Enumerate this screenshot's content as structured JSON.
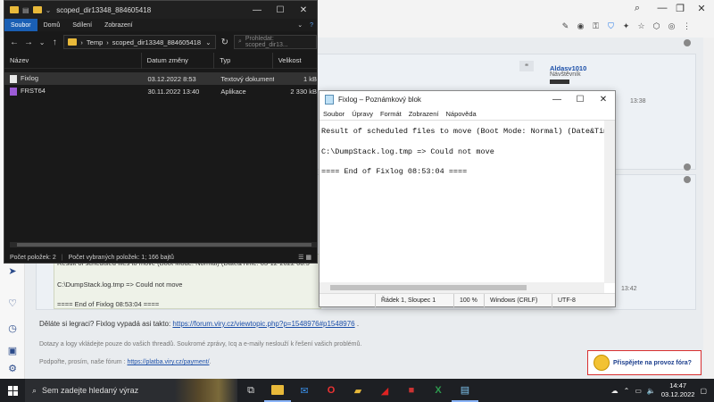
{
  "browser": {
    "forum": {
      "user_name": "Aldasv1010",
      "user_role": "Návštěvník",
      "time_top": "13:38",
      "time_bottom": "13:42",
      "quote_line1": "Result of scheduled files to move (Boot Mode: Normal) (Date&Time: 03-12-2022 08:5",
      "quote_line2": "C:\\DumpStack.log.tmp => Could not move",
      "quote_line3": "==== End of Fixlog 08:53:04 ====",
      "legacy_text": "Děláte si legraci? Fixlog vypadá asi takto:",
      "legacy_link": "https://forum.viry.cz/viewtopic.php?p=1548976#p1548976",
      "note1": "Dotazy a logy vkládejte pouze do vašich threadů. Soukromé zprávy, Icq a e-maily neslouží k řešení vašich problémů.",
      "note2": "Podpořte, prosím, naše fórum :",
      "note2_link": "https://platba.viry.cz/payment/",
      "donate_label": "Přispějete na provoz fóra?"
    }
  },
  "explorer": {
    "title": "scoped_dir13348_884605418",
    "ribbon": [
      "Soubor",
      "Domů",
      "Sdílení",
      "Zobrazení"
    ],
    "breadcrumb_root": "Temp",
    "breadcrumb_leaf": "scoped_dir13348_884605418",
    "search_placeholder": "Prohledat: scoped_dir13...",
    "columns": [
      "Název",
      "Datum změny",
      "Typ",
      "Velikost"
    ],
    "rows": [
      {
        "name": "Fixlog",
        "date": "03.12.2022 8:53",
        "type": "Textový dokument",
        "size": "1 kB"
      },
      {
        "name": "FRST64",
        "date": "30.11.2022 13:40",
        "type": "Aplikace",
        "size": "2 330 kB"
      }
    ],
    "status_count": "Počet položek: 2",
    "status_selected": "Počet vybraných položek: 1; 166 bajtů"
  },
  "notepad": {
    "title": "Fixlog – Poznámkový blok",
    "menu": [
      "Soubor",
      "Úpravy",
      "Formát",
      "Zobrazení",
      "Nápověda"
    ],
    "lines": [
      "Result of scheduled files to move (Boot Mode: Normal) (Date&Time",
      "",
      "C:\\DumpStack.log.tmp => Could not move",
      "",
      "==== End of Fixlog 08:53:04 ===="
    ],
    "status_pos": "Řádek 1, Sloupec 1",
    "status_zoom": "100 %",
    "status_eol": "Windows (CRLF)",
    "status_enc": "UTF-8"
  },
  "taskbar": {
    "search_placeholder": "Sem zadejte hledaný výraz",
    "time": "14:47",
    "date": "03.12.2022"
  },
  "colors": {
    "accent": "#1a5fb4",
    "link": "#1a4ea8",
    "donate_border": "#d83030"
  }
}
